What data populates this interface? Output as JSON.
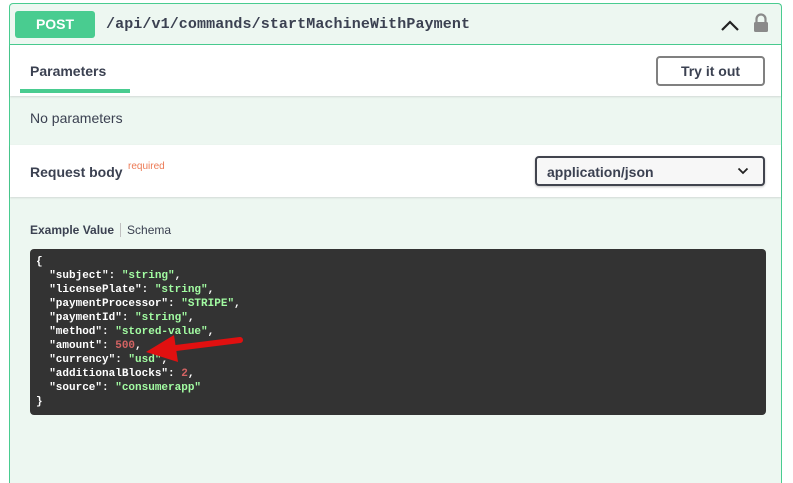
{
  "operation": {
    "method": "POST",
    "path": "/api/v1/commands/startMachineWithPayment"
  },
  "tabs": {
    "parameters_label": "Parameters",
    "try_it_out_label": "Try it out"
  },
  "parameters": {
    "empty_text": "No parameters"
  },
  "request_body": {
    "title": "Request body",
    "required_label": "required",
    "content_type": "application/json"
  },
  "example_tabs": {
    "example_value_label": "Example Value",
    "schema_label": "Schema"
  },
  "example": {
    "open_brace": "{",
    "close_brace": "}",
    "fields": [
      {
        "key": "\"subject\"",
        "value": "\"string\"",
        "type": "string",
        "comma": ","
      },
      {
        "key": "\"licensePlate\"",
        "value": "\"string\"",
        "type": "string",
        "comma": ","
      },
      {
        "key": "\"paymentProcessor\"",
        "value": "\"STRIPE\"",
        "type": "string",
        "comma": ","
      },
      {
        "key": "\"paymentId\"",
        "value": "\"string\"",
        "type": "string",
        "comma": ","
      },
      {
        "key": "\"method\"",
        "value": "\"stored-value\"",
        "type": "string",
        "comma": ","
      },
      {
        "key": "\"amount\"",
        "value": "500",
        "type": "number",
        "comma": ","
      },
      {
        "key": "\"currency\"",
        "value": "\"usd\"",
        "type": "string",
        "comma": ","
      },
      {
        "key": "\"additionalBlocks\"",
        "value": "2",
        "type": "number",
        "comma": ","
      },
      {
        "key": "\"source\"",
        "value": "\"consumerapp\"",
        "type": "string",
        "comma": ""
      }
    ]
  },
  "colors": {
    "post_accent": "#49cc90",
    "block_background": "#edf7f1",
    "code_background": "#333333",
    "string_color": "#a2fca2",
    "number_color": "#d36363",
    "required_color": "#ec7a55",
    "annotation_arrow": "#e01010"
  },
  "icons": {
    "collapse": "chevron-up-icon",
    "lock": "lock-icon",
    "dropdown": "chevron-down-icon",
    "annotation": "red-arrow-icon"
  }
}
